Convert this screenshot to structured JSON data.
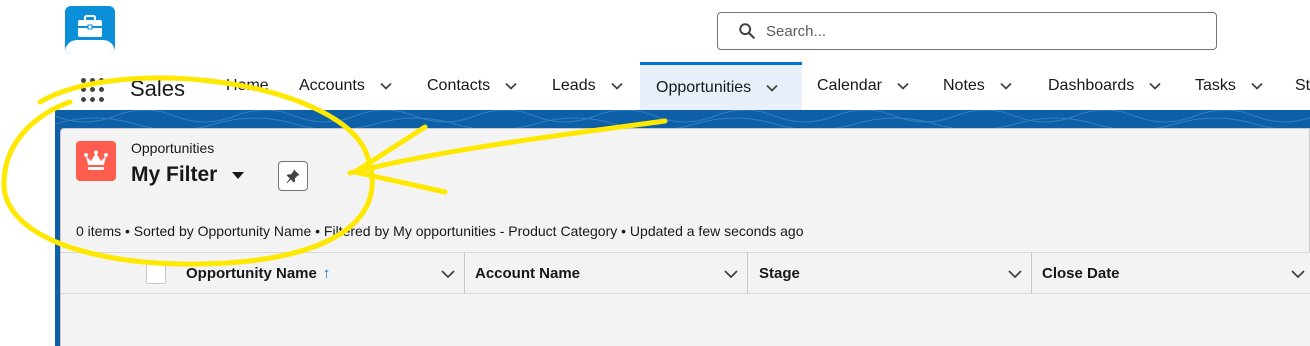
{
  "header": {
    "search_placeholder": "Search..."
  },
  "nav": {
    "app_name": "Sales",
    "items": [
      {
        "label": "Home",
        "has_menu": false
      },
      {
        "label": "Accounts",
        "has_menu": true
      },
      {
        "label": "Contacts",
        "has_menu": true
      },
      {
        "label": "Leads",
        "has_menu": true
      },
      {
        "label": "Opportunities",
        "has_menu": true,
        "active": true
      },
      {
        "label": "Calendar",
        "has_menu": true
      },
      {
        "label": "Notes",
        "has_menu": true
      },
      {
        "label": "Dashboards",
        "has_menu": true
      },
      {
        "label": "Tasks",
        "has_menu": true
      },
      {
        "label": "St",
        "has_menu": false
      }
    ]
  },
  "list_view": {
    "object_label": "Opportunities",
    "view_name": "My Filter",
    "summary": "0 items • Sorted by Opportunity Name • Filtered by My opportunities - Product Category • Updated a few seconds ago",
    "columns": [
      {
        "label": "Opportunity Name",
        "sorted": "ascending",
        "sort_icon": "↑"
      },
      {
        "label": "Account Name"
      },
      {
        "label": "Stage"
      },
      {
        "label": "Close Date"
      }
    ]
  },
  "colors": {
    "brand_blue": "#0176d3",
    "banner_blue": "#0d5fa8",
    "opportunity_icon": "#fe5c4c",
    "annotation_yellow": "#ffe800"
  },
  "icons": {
    "app_logo": "briefcase-icon",
    "search": "search-icon",
    "app_launcher": "waffle-icon",
    "object": "crown-icon",
    "pin": "pin-icon",
    "menu": "chevron-down-icon"
  }
}
